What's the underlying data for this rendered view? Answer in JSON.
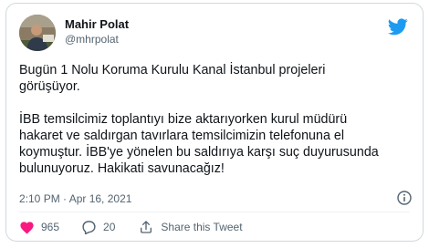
{
  "tweet": {
    "author_name": "Mahir Polat",
    "author_handle": "@mhrpolat",
    "paragraphs": [
      "Bugün 1 Nolu Koruma Kurulu Kanal İstanbul projeleri\ngörüşüyor.",
      "İBB temsilcimiz toplantıyı bize aktarıyorken kurul müdürü\nhakaret ve  saldırgan tavırlara temsilcimizin telefonuna el\nkoymuştur. İBB'ye yönelen bu saldırıya karşı suç duyurusunda\nbulunuyoruz. Hakikati savunacağız!"
    ],
    "timestamp": "2:10 PM · Apr 16, 2021"
  },
  "actions": {
    "like_count": "965",
    "reply_count": "20",
    "share_label": "Share this Tweet"
  },
  "icons": {
    "brand": "twitter-bird-icon",
    "info": "info-icon",
    "like": "heart-icon",
    "reply": "speech-bubble-icon",
    "share": "share-icon"
  },
  "colors": {
    "brand_blue": "#1d9bf0",
    "like_red": "#f91880",
    "text_primary": "#0f1419",
    "text_secondary": "#536471",
    "border": "#cfd9de"
  }
}
